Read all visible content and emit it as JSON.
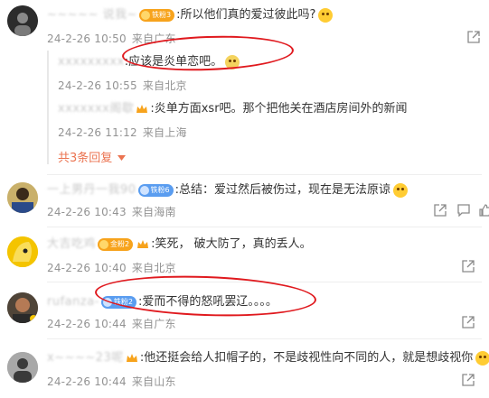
{
  "comments": [
    {
      "user": "~~~~~ 说我~",
      "badge": "铁粉3",
      "text": ":所以他们真的爱过彼此吗?",
      "time": "24-2-26 10:50",
      "loc": "来自广东",
      "replies": [
        {
          "user": "xxxxxxxxx",
          "text": ":应该是炎单恋吧。",
          "time": "24-2-26 10:55",
          "loc": "来自北京"
        },
        {
          "user": "xxxxxxx阁歇",
          "text": ":炎单方面xsr吧。那个把他关在酒店房间外的新闻",
          "time": "24-2-26 11:12",
          "loc": "来自上海"
        }
      ],
      "more": "共3条回复"
    },
    {
      "user": "一上男丹一我90",
      "badge": "铁粉6",
      "text": ":总结：爱过然后被伤过，现在是无法原谅",
      "time": "24-2-26 10:43",
      "loc": "来自海南"
    },
    {
      "user": "大吉吃鸡",
      "badge": "金粉2",
      "text": ":笑死， 破大防了，真的丢人。",
      "time": "24-2-26 10:40",
      "loc": "来自北京"
    },
    {
      "user": "rufanza-",
      "badge": "铁粉2",
      "text": ":爱而不得的怒吼罢辽。。。。",
      "time": "24-2-26 10:44",
      "loc": "来自广东"
    },
    {
      "user": "x~~~~23呢",
      "badge": "",
      "text": ":他还挺会给人扣帽子的，不是歧视性向不同的人，就是想歧视你",
      "time": "24-2-26 10:44",
      "loc": "来自山东"
    }
  ],
  "colors": {
    "accent": "#eb7350",
    "annotation": "#e0191e",
    "meta": "#939393"
  },
  "icons": {
    "share": "share-icon",
    "comment": "comment-icon",
    "like": "like-icon",
    "more": "chevron-down-icon"
  }
}
